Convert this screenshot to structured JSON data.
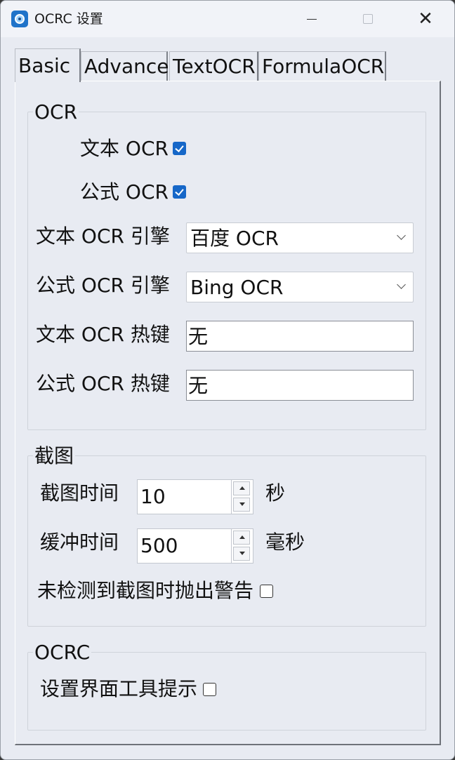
{
  "window": {
    "title": "OCRC 设置",
    "icon": "camera-icon"
  },
  "tabs": [
    {
      "label": "Basic",
      "active": true
    },
    {
      "label": "Advance",
      "active": false
    },
    {
      "label": "TextOCR",
      "active": false
    },
    {
      "label": "FormulaOCR",
      "active": false
    }
  ],
  "ocr_group": {
    "title": "OCR",
    "text_ocr_label": "文本 OCR",
    "text_ocr_checked": true,
    "formula_ocr_label": "公式 OCR",
    "formula_ocr_checked": true,
    "text_engine_label": "文本 OCR 引擎",
    "text_engine_value": "百度 OCR",
    "formula_engine_label": "公式 OCR 引擎",
    "formula_engine_value": "Bing OCR",
    "text_hotkey_label": "文本 OCR 热键",
    "text_hotkey_value": "无",
    "formula_hotkey_label": "公式 OCR 热键",
    "formula_hotkey_value": "无"
  },
  "screenshot_group": {
    "title": "截图",
    "capture_time_label": "截图时间",
    "capture_time_value": "10",
    "capture_time_unit": "秒",
    "buffer_time_label": "缓冲时间",
    "buffer_time_value": "500",
    "buffer_time_unit": "毫秒",
    "warn_label": "未检测到截图时抛出警告",
    "warn_checked": false
  },
  "ocrc_group": {
    "title": "OCRC",
    "tooltip_label": "设置界面工具提示",
    "tooltip_checked": false
  }
}
